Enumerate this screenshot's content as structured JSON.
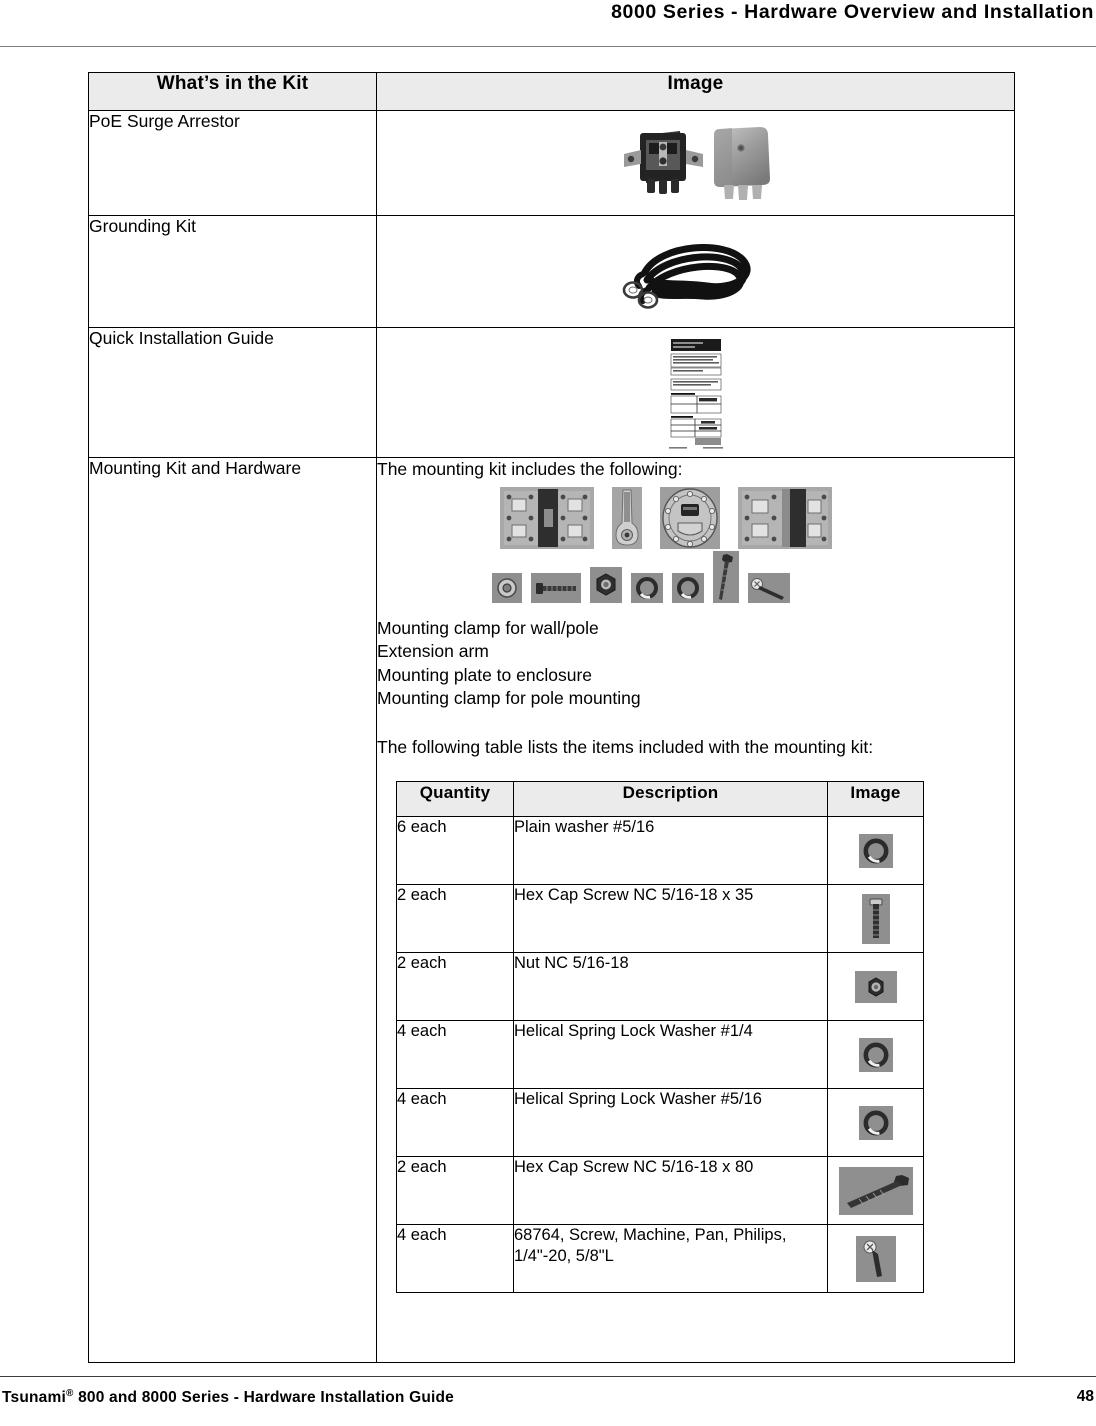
{
  "header": {
    "title": "8000 Series - Hardware Overview and Installation"
  },
  "kit_table": {
    "columns": [
      "What’s in the Kit",
      "Image"
    ],
    "rows": [
      {
        "label": "PoE Surge Arrestor",
        "image": "poe-surge-arrestor-photo"
      },
      {
        "label": "Grounding Kit",
        "image": "grounding-cable-photo"
      },
      {
        "label": "Quick Installation Guide",
        "image": "quick-install-guide-photo"
      },
      {
        "label": "Mounting Kit and Hardware",
        "image": "mounting-kit-content"
      }
    ]
  },
  "mounting": {
    "intro": "The mounting kit includes the following:",
    "items": [
      "Mounting clamp for wall/pole",
      "Extension arm",
      "Mounting plate to enclosure",
      "Mounting clamp for pole mounting"
    ],
    "table_intro": "The following table lists the items included with the mounting kit:",
    "figures_row1": [
      "mounting-clamp-wall-pole-photo",
      "extension-arm-photo",
      "mounting-plate-enclosure-photo",
      "mounting-clamp-pole-photo"
    ],
    "figures_row2": [
      "plain-washer-photo",
      "hex-cap-screw-35-photo",
      "hex-nut-photo",
      "lock-washer-quarter-photo",
      "lock-washer-five-sixteenth-photo",
      "hex-cap-screw-80-photo",
      "machine-screw-photo"
    ]
  },
  "parts_table": {
    "columns": [
      "Quantity",
      "Description",
      "Image"
    ],
    "rows": [
      {
        "quantity": "6 each",
        "description": "Plain washer #5/16",
        "image": "plain-washer-photo"
      },
      {
        "quantity": "2 each",
        "description": "Hex Cap Screw NC 5/16-18 x 35",
        "image": "hex-cap-screw-35-photo"
      },
      {
        "quantity": "2 each",
        "description": "Nut NC 5/16-18",
        "image": "hex-nut-photo"
      },
      {
        "quantity": "4 each",
        "description": "Helical Spring Lock Washer #1/4",
        "image": "lock-washer-quarter-photo"
      },
      {
        "quantity": "4 each",
        "description": "Helical Spring Lock Washer #5/16",
        "image": "lock-washer-five-sixteenth-photo"
      },
      {
        "quantity": "2 each",
        "description": "Hex Cap Screw NC 5/16-18 x 80",
        "image": "hex-cap-screw-80-photo"
      },
      {
        "quantity": "4 each",
        "description": "68764, Screw, Machine, Pan, Philips, 1/4\"-20, 5/8\"L",
        "image": "machine-screw-photo"
      }
    ]
  },
  "footer": {
    "guide_name_pre": "Tsunami",
    "guide_name_sup": "®",
    "guide_name_post": " 800 and 8000 Series - Hardware Installation Guide",
    "page_number": "48"
  },
  "colors": {
    "header_fill": "#ebebeb",
    "border": "#000000",
    "rule": "#7d7d7d"
  }
}
